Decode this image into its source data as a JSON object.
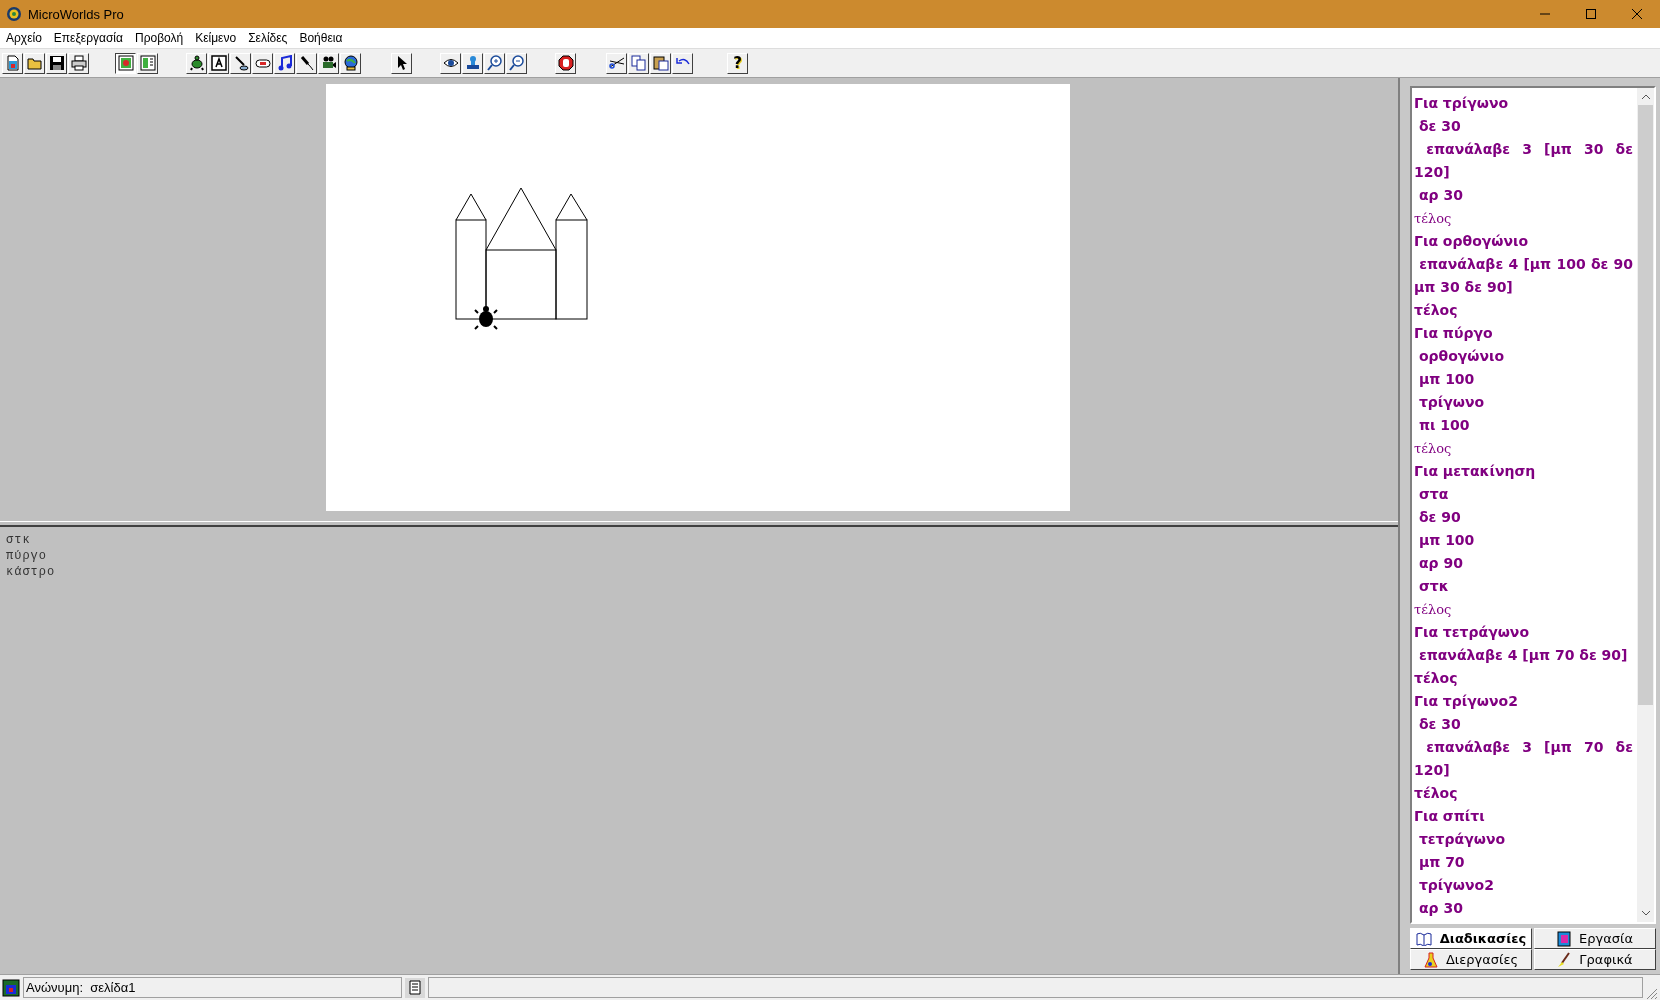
{
  "window": {
    "title": "MicroWorlds Pro"
  },
  "menu": [
    "Αρχείο",
    "Επεξεργασία",
    "Προβολή",
    "Κείμενο",
    "Σελίδες",
    "Βοήθεια"
  ],
  "toolbar": {
    "help": "?"
  },
  "command_center": {
    "lines": [
      "στκ",
      "πύργο",
      "κάστρο"
    ]
  },
  "procedures": {
    "lines": [
      {
        "text": "Για τρίγωνο",
        "kind": "bold"
      },
      {
        "text": " δε 30",
        "kind": "bold"
      },
      {
        "text": " επανάλαβε 3 [μπ 30 δε 120]",
        "kind": "bold"
      },
      {
        "text": " αρ 30",
        "kind": "bold"
      },
      {
        "text": "τέλος",
        "kind": "plain"
      },
      {
        "text": "Για ορθογώνιο",
        "kind": "bold"
      },
      {
        "text": " επανάλαβε 4 [μπ 100 δε 90 μπ 30 δε 90]",
        "kind": "bold"
      },
      {
        "text": "τέλος",
        "kind": "bold"
      },
      {
        "text": "Για πύργο",
        "kind": "bold"
      },
      {
        "text": " ορθογώνιο",
        "kind": "bold"
      },
      {
        "text": " μπ 100",
        "kind": "bold"
      },
      {
        "text": " τρίγωνο",
        "kind": "bold"
      },
      {
        "text": " πι 100",
        "kind": "bold"
      },
      {
        "text": "τέλος",
        "kind": "plain"
      },
      {
        "text": "Για μετακίνηση",
        "kind": "bold"
      },
      {
        "text": " στα",
        "kind": "bold"
      },
      {
        "text": " δε 90",
        "kind": "bold"
      },
      {
        "text": " μπ 100",
        "kind": "bold"
      },
      {
        "text": " αρ 90",
        "kind": "bold"
      },
      {
        "text": " στκ",
        "kind": "bold"
      },
      {
        "text": "τέλος",
        "kind": "plain"
      },
      {
        "text": "Για τετράγωνο",
        "kind": "bold"
      },
      {
        "text": " επανάλαβε 4 [μπ 70 δε 90]",
        "kind": "bold"
      },
      {
        "text": "τέλος",
        "kind": "bold"
      },
      {
        "text": "Για τρίγωνο2",
        "kind": "bold"
      },
      {
        "text": " δε 30",
        "kind": "bold"
      },
      {
        "text": " επανάλαβε 3 [μπ 70 δε 120]",
        "kind": "bold"
      },
      {
        "text": "τέλος",
        "kind": "bold"
      },
      {
        "text": "Για σπίτι",
        "kind": "bold"
      },
      {
        "text": " τετράγωνο",
        "kind": "bold"
      },
      {
        "text": " μπ 70",
        "kind": "bold"
      },
      {
        "text": " τρίγωνο2",
        "kind": "bold"
      },
      {
        "text": " αρ 30",
        "kind": "bold"
      }
    ]
  },
  "tabs": [
    {
      "label": "Διαδικασίες",
      "selected": true
    },
    {
      "label": "Εργασία",
      "selected": false
    },
    {
      "label": "Διεργασίες",
      "selected": false
    },
    {
      "label": "Γραφικά",
      "selected": false
    }
  ],
  "status_bar": {
    "page": "Ανώνυμη:  σελίδα1"
  }
}
